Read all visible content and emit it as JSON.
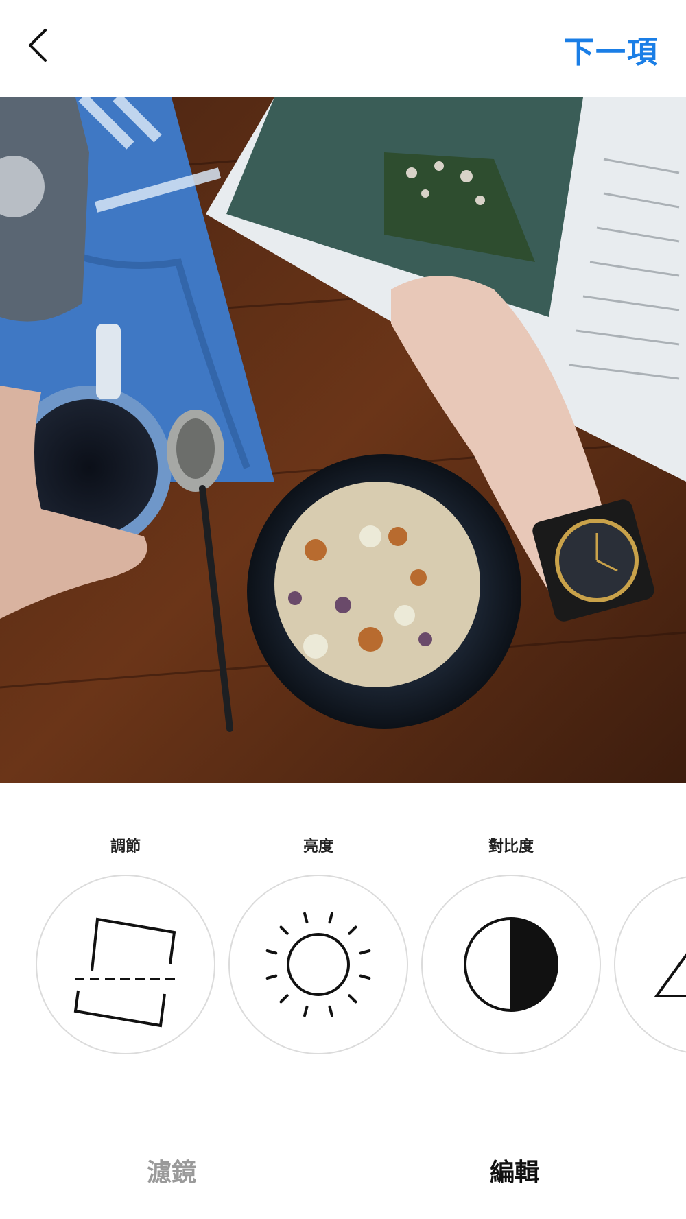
{
  "header": {
    "next_label": "下一項"
  },
  "photo": {
    "description_icon": "photo-preview"
  },
  "tools": [
    {
      "label": "調節",
      "icon": "adjust-icon"
    },
    {
      "label": "亮度",
      "icon": "brightness-icon"
    },
    {
      "label": "對比度",
      "icon": "contrast-icon"
    },
    {
      "label": "",
      "icon": "structure-icon"
    }
  ],
  "tabs": {
    "filter_label": "濾鏡",
    "edit_label": "編輯",
    "active": "edit"
  },
  "colors": {
    "accent": "#1a7ee6",
    "inactive_tab": "#9a9a9a",
    "circle_border": "#dbdbdb"
  }
}
